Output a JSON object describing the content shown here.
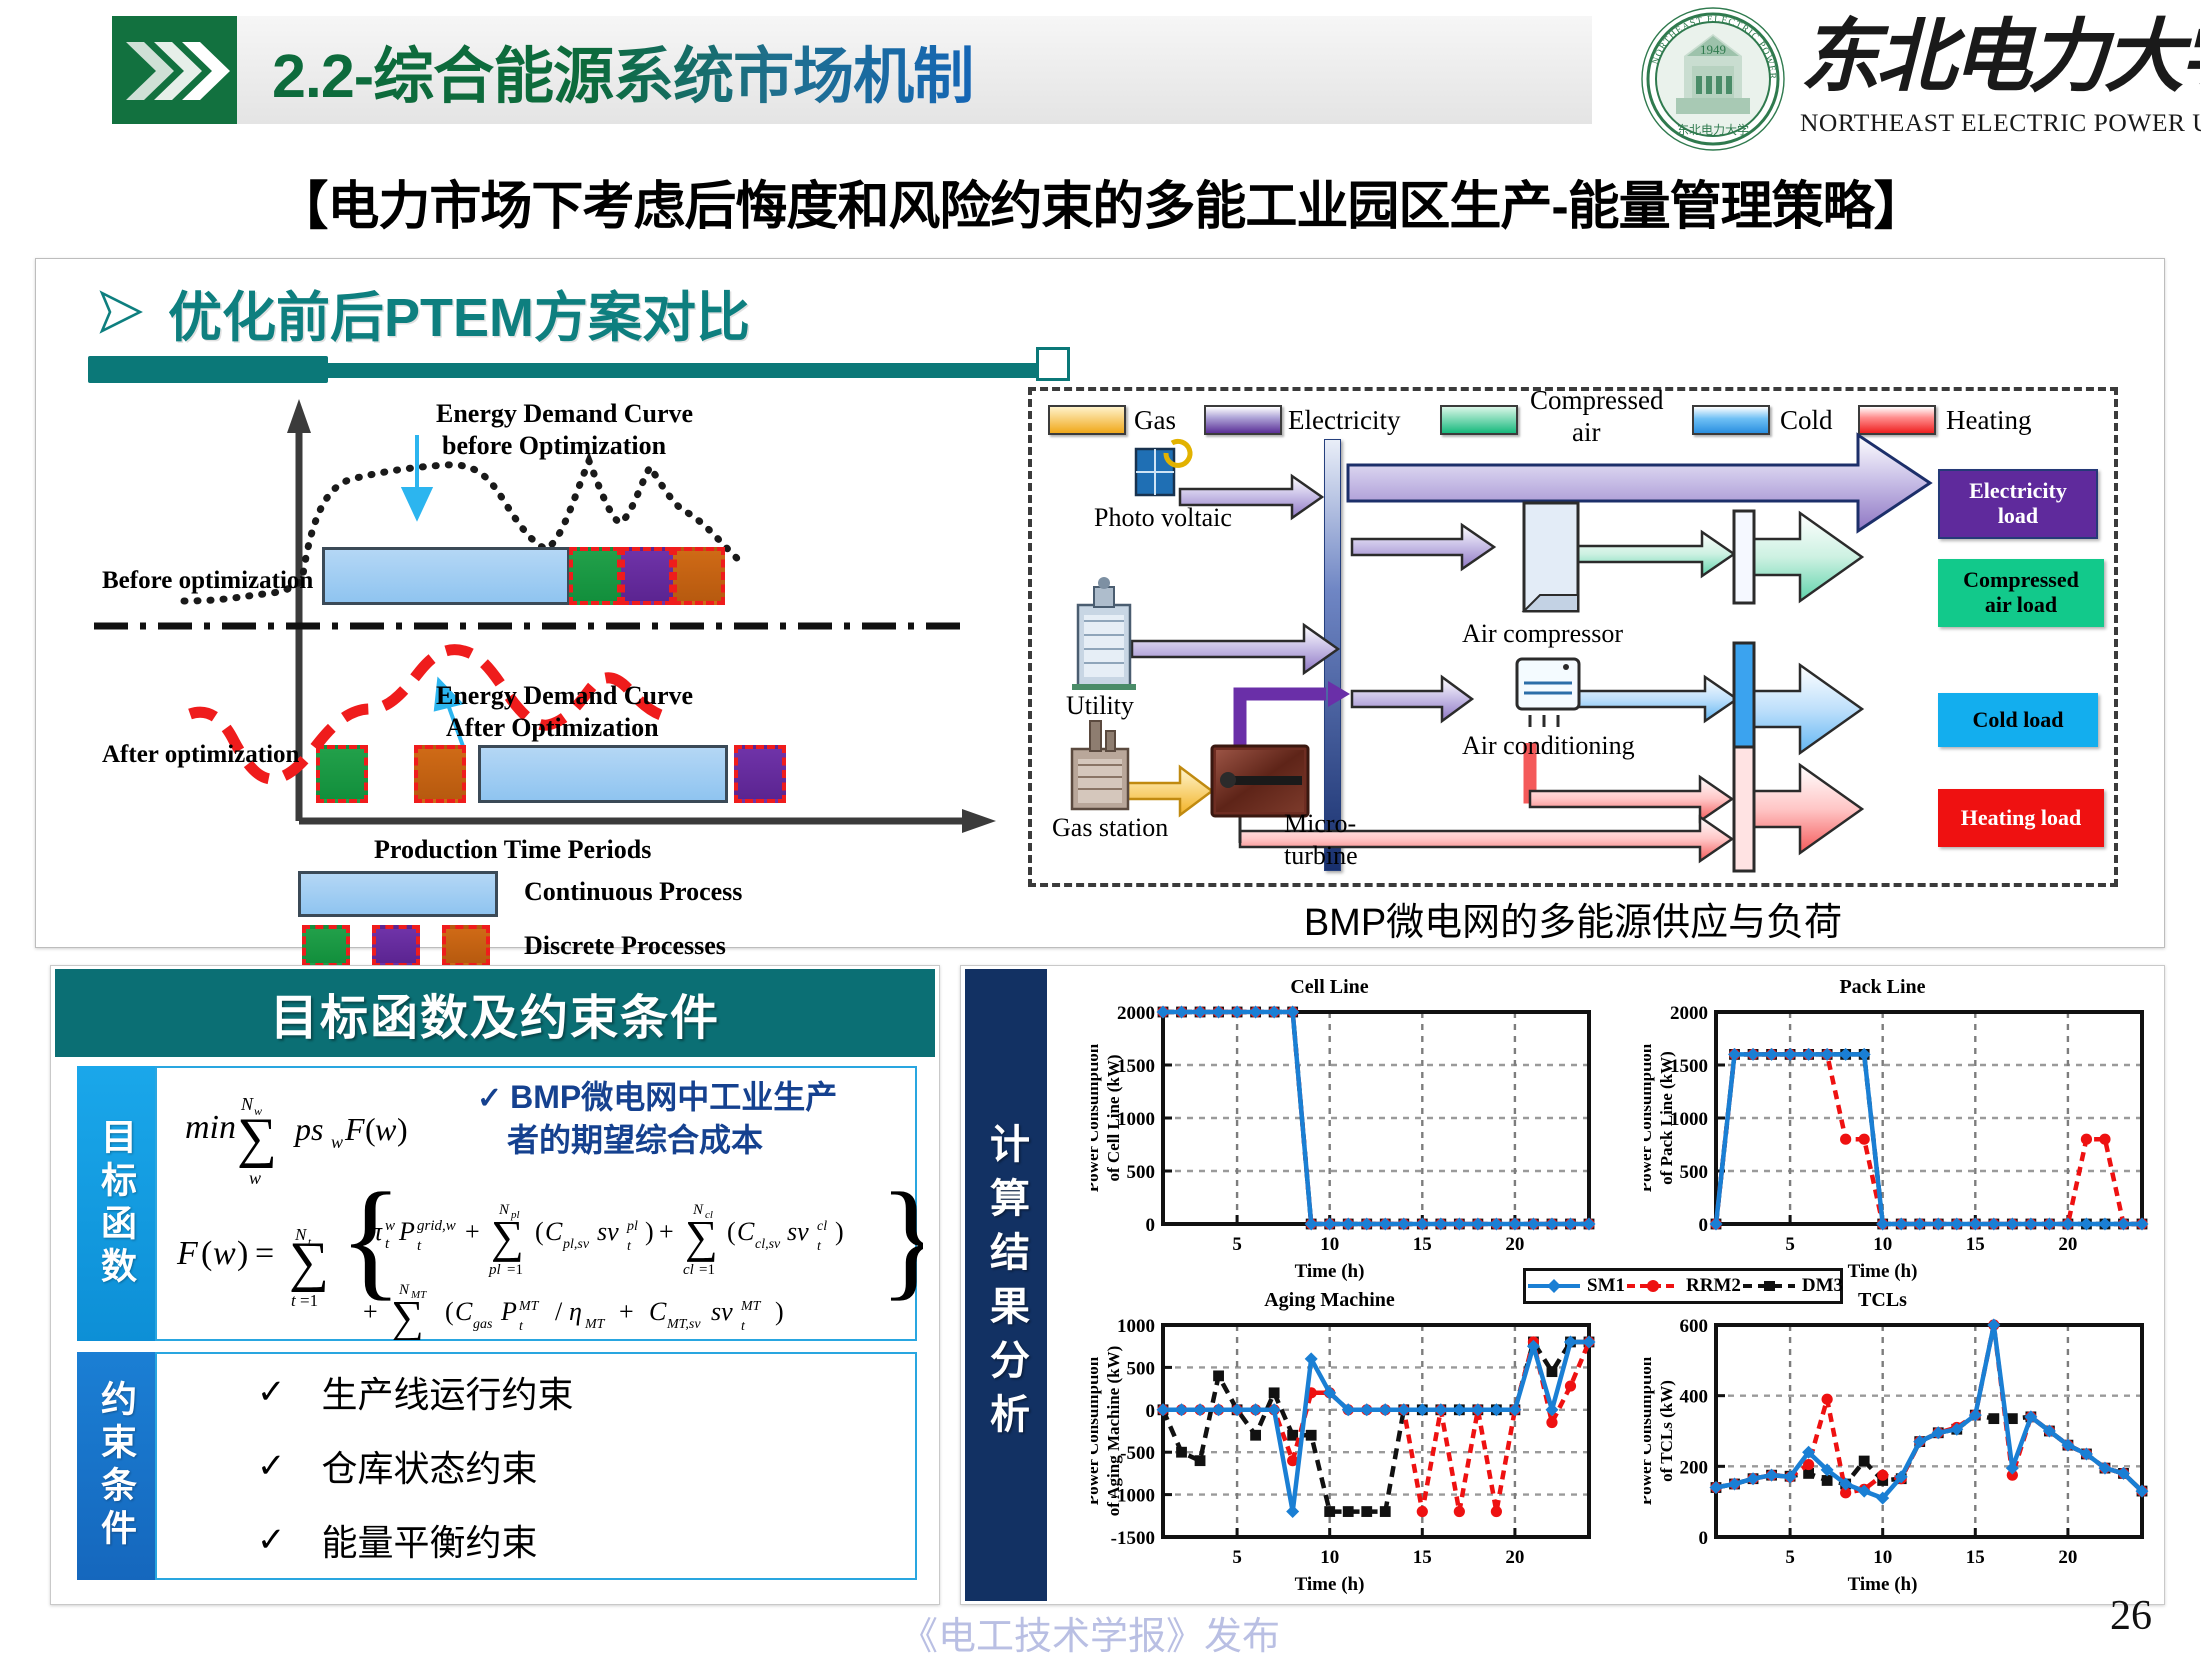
{
  "header": {
    "title": "2.2-综合能源系统市场机制",
    "logo": {
      "seal_year": "1949",
      "cn_name": "东北电力大学",
      "en_name": "NORTHEAST ELECTRIC POWER UNIVERSITY"
    }
  },
  "subtitle": "【电力市场下考虑后悔度和风险约束的多能工业园区生产-能量管理策略】",
  "upper": {
    "bullet": "优化前后PTEM方案对比",
    "schematic": {
      "before_label": "Before optimization",
      "after_label": "After optimization",
      "curve_before": "Energy Demand Curve\nbefore Optimization",
      "curve_before_l1": "Energy Demand Curve",
      "curve_before_l2": "before Optimization",
      "curve_after_l1": "Energy Demand Curve",
      "curve_after_l2": "After Optimization",
      "xaxis": "Production Time Periods",
      "legend_continuous": "Continuous Process",
      "legend_discrete": "Discrete Processes"
    },
    "energy": {
      "legend": [
        {
          "label": "Gas",
          "color": "#f5a81c"
        },
        {
          "label": "Electricity",
          "color": "#6a3aa8"
        },
        {
          "label": "Compressed\nair",
          "color": "#17b97d"
        },
        {
          "label": "Compressed",
          "color": "#17b97d"
        },
        {
          "label": "air",
          "color": "#17b97d"
        },
        {
          "label": "Cold",
          "color": "#2196f3"
        },
        {
          "label": "Heating",
          "color": "#ef2020"
        }
      ],
      "legend_gas": "Gas",
      "legend_electricity": "Electricity",
      "legend_compressed_1": "Compressed",
      "legend_compressed_2": "air",
      "legend_cold": "Cold",
      "legend_heating": "Heating",
      "sources": [
        "Photo voltaic",
        "Utility",
        "Gas station"
      ],
      "src_pv": "Photo voltaic",
      "src_utility": "Utility",
      "src_gas": "Gas station",
      "devices": [
        "Air compressor",
        "Air conditioning",
        "Micro-",
        "turbine"
      ],
      "dev_compressor": "Air compressor",
      "dev_aircon": "Air conditioning",
      "dev_mt_1": "Micro-",
      "dev_mt_2": "turbine",
      "loads": [
        {
          "l1": "Electricity",
          "l2": "load",
          "bg": "#5f2a9c",
          "fg": "#ffffff"
        },
        {
          "l1": "Compressed",
          "l2": "air load",
          "bg": "#12c98b",
          "fg": "#000000"
        },
        {
          "l1": "Cold load",
          "l2": "",
          "bg": "#13aeee",
          "fg": "#000000"
        },
        {
          "l1": "Heating load",
          "l2": "",
          "bg": "#ef1111",
          "fg": "#ffffff"
        }
      ],
      "caption": "BMP微电网的多能源供应与负荷"
    }
  },
  "formula": {
    "heading": "目标函数及约束条件",
    "objective_tab": "目标函数",
    "objective_note_1": "BMP微电网中工业生产",
    "objective_note_2": "者的期望综合成本",
    "check": "✓",
    "constraint_tab": "约束条件",
    "constraints": [
      "生产线运行约束",
      "仓库状态约束",
      "能量平衡约束"
    ]
  },
  "results": {
    "vertical_tab": "计算结果分析"
  },
  "footer": {
    "watermark": "《电工技术学报》发布",
    "page_number": "26"
  },
  "chart_data": [
    {
      "type": "line",
      "title": "Cell Line",
      "xlabel": "Time (h)",
      "ylabel": "Power Consumption\nof Cell Line (kW)",
      "ylabel_l1": "Power Consumption",
      "ylabel_l2": "of Cell Line (kW)",
      "x": [
        1,
        2,
        3,
        4,
        5,
        6,
        7,
        8,
        9,
        10,
        11,
        12,
        13,
        14,
        15,
        16,
        17,
        18,
        19,
        20,
        21,
        22,
        23,
        24
      ],
      "xticks": [
        5,
        10,
        15,
        20
      ],
      "yticks": [
        0,
        500,
        1000,
        1500,
        2000
      ],
      "xlim": [
        1,
        24
      ],
      "ylim": [
        0,
        2000
      ],
      "grid": true,
      "series": [
        {
          "name": "SM1",
          "color": "#1a7fd4",
          "values": [
            2000,
            2000,
            2000,
            2000,
            2000,
            2000,
            2000,
            2000,
            0,
            0,
            0,
            0,
            0,
            0,
            0,
            0,
            0,
            0,
            0,
            0,
            0,
            0,
            0,
            0
          ]
        },
        {
          "name": "RRM2",
          "color": "#ee1111",
          "values": [
            2000,
            2000,
            2000,
            2000,
            2000,
            2000,
            2000,
            2000,
            0,
            0,
            0,
            0,
            0,
            0,
            0,
            0,
            0,
            0,
            0,
            0,
            0,
            0,
            0,
            0
          ]
        },
        {
          "name": "DM3",
          "color": "#111111",
          "values": [
            2000,
            2000,
            2000,
            2000,
            2000,
            2000,
            2000,
            2000,
            0,
            0,
            0,
            0,
            0,
            0,
            0,
            0,
            0,
            0,
            0,
            0,
            0,
            0,
            0,
            0
          ]
        }
      ]
    },
    {
      "type": "line",
      "title": "Pack Line",
      "xlabel": "Time (h)",
      "ylabel": "Power Consumption\nof Pack Line (kW)",
      "ylabel_l1": "Power Consumption",
      "ylabel_l2": "of Pack Line (kW)",
      "x": [
        1,
        2,
        3,
        4,
        5,
        6,
        7,
        8,
        9,
        10,
        11,
        12,
        13,
        14,
        15,
        16,
        17,
        18,
        19,
        20,
        21,
        22,
        23,
        24
      ],
      "xticks": [
        5,
        10,
        15,
        20
      ],
      "yticks": [
        0,
        500,
        1000,
        1500,
        2000
      ],
      "xlim": [
        1,
        24
      ],
      "ylim": [
        0,
        2000
      ],
      "grid": true,
      "series": [
        {
          "name": "SM1",
          "color": "#1a7fd4",
          "values": [
            0,
            1600,
            1600,
            1600,
            1600,
            1600,
            1600,
            1600,
            1600,
            0,
            0,
            0,
            0,
            0,
            0,
            0,
            0,
            0,
            0,
            0,
            0,
            0,
            0,
            0
          ]
        },
        {
          "name": "RRM2",
          "color": "#ee1111",
          "values": [
            0,
            1600,
            1600,
            1600,
            1600,
            1600,
            1600,
            800,
            800,
            0,
            0,
            0,
            0,
            0,
            0,
            0,
            0,
            0,
            0,
            0,
            800,
            800,
            0,
            0
          ]
        },
        {
          "name": "DM3",
          "color": "#111111",
          "values": [
            0,
            1600,
            1600,
            1600,
            1600,
            1600,
            1600,
            1600,
            1600,
            0,
            0,
            0,
            0,
            0,
            0,
            0,
            0,
            0,
            0,
            0,
            0,
            0,
            0,
            0
          ]
        }
      ]
    },
    {
      "type": "line",
      "title": "Aging Machine",
      "xlabel": "Time (h)",
      "ylabel": "Power Consumption\nof Aging Machine (kW)",
      "ylabel_l1": "Power Consumption",
      "ylabel_l2": "of Aging Machine (kW)",
      "x": [
        1,
        2,
        3,
        4,
        5,
        6,
        7,
        8,
        9,
        10,
        11,
        12,
        13,
        14,
        15,
        16,
        17,
        18,
        19,
        20,
        21,
        22,
        23,
        24
      ],
      "xticks": [
        5,
        10,
        15,
        20
      ],
      "yticks": [
        -1500,
        -1000,
        -500,
        0,
        500,
        1000
      ],
      "xlim": [
        1,
        24
      ],
      "ylim": [
        -1500,
        1000
      ],
      "grid": true,
      "series": [
        {
          "name": "SM1",
          "color": "#1a7fd4",
          "values": [
            0,
            0,
            0,
            0,
            0,
            0,
            0,
            -1200,
            600,
            200,
            0,
            0,
            0,
            0,
            0,
            0,
            0,
            0,
            0,
            0,
            750,
            0,
            800,
            800
          ]
        },
        {
          "name": "RRM2",
          "color": "#ee1111",
          "values": [
            0,
            0,
            0,
            0,
            0,
            0,
            0,
            -600,
            200,
            200,
            0,
            0,
            0,
            0,
            -1200,
            0,
            -1200,
            0,
            -1200,
            0,
            800,
            -150,
            280,
            800
          ]
        },
        {
          "name": "DM3",
          "color": "#111111",
          "values": [
            0,
            -500,
            -600,
            400,
            0,
            -300,
            200,
            -300,
            -300,
            -1200,
            -1200,
            -1200,
            -1200,
            0,
            0,
            0,
            0,
            0,
            0,
            0,
            800,
            450,
            800,
            800
          ]
        }
      ]
    },
    {
      "type": "line",
      "title": "TCLs",
      "xlabel": "Time (h)",
      "ylabel": "Power Consumption\nof TCLs (kW)",
      "ylabel_l1": "Power Consumption",
      "ylabel_l2": "of TCLs (kW)",
      "x": [
        1,
        2,
        3,
        4,
        5,
        6,
        7,
        8,
        9,
        10,
        11,
        12,
        13,
        14,
        15,
        16,
        17,
        18,
        19,
        20,
        21,
        22,
        23,
        24
      ],
      "xticks": [
        5,
        10,
        15,
        20
      ],
      "yticks": [
        0,
        200,
        400,
        600
      ],
      "xlim": [
        1,
        24
      ],
      "ylim": [
        0,
        600
      ],
      "grid": true,
      "series": [
        {
          "name": "SM1",
          "color": "#1a7fd4",
          "values": [
            140,
            150,
            165,
            175,
            170,
            240,
            190,
            150,
            130,
            110,
            170,
            270,
            295,
            305,
            345,
            600,
            195,
            340,
            300,
            260,
            235,
            195,
            180,
            130
          ]
        },
        {
          "name": "RRM2",
          "color": "#ee1111",
          "values": [
            140,
            150,
            165,
            175,
            170,
            205,
            390,
            125,
            135,
            175,
            165,
            270,
            295,
            310,
            345,
            600,
            175,
            340,
            300,
            260,
            235,
            195,
            180,
            130
          ]
        },
        {
          "name": "DM3",
          "color": "#111111",
          "values": [
            140,
            150,
            165,
            175,
            172,
            180,
            160,
            150,
            215,
            160,
            165,
            270,
            295,
            305,
            345,
            335,
            335,
            340,
            300,
            260,
            235,
            195,
            180,
            130
          ]
        }
      ]
    }
  ],
  "chart_legend": [
    {
      "name": "SM1",
      "color": "#1a7fd4",
      "marker": "diamond",
      "style": "solid"
    },
    {
      "name": "RRM2",
      "color": "#ee1111",
      "marker": "circle",
      "style": "dashed"
    },
    {
      "name": "DM3",
      "color": "#111111",
      "marker": "square",
      "style": "dashed"
    }
  ]
}
